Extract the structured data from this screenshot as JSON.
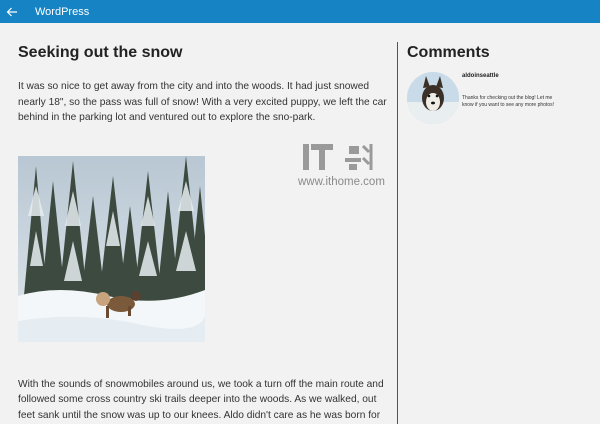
{
  "app": {
    "title": "WordPress"
  },
  "post": {
    "title": "Seeking out the snow",
    "paragraph1": "It was so nice to get away from the city and into the woods.  It had just snowed nearly 18\", so the pass was full of snow!  With a very excited puppy, we left the car behind in the parking lot and ventured out to explore the sno-park.",
    "paragraph2": "With the sounds of snowmobiles around us, we took a turn off the main route and followed some cross country ski trails deeper into the woods.  As we walked, out feet sank until the snow was up to our knees.  Aldo didn't care as he was born for this weather.  When we found a clearing, we brought out the camera gear so"
  },
  "comments": {
    "title": "Comments",
    "items": [
      {
        "user": "aldoinseattle",
        "text": "Thanks for checking out the blog! Let me know if you want to see any more photos!"
      }
    ]
  },
  "watermark": {
    "text": "www.ithome.com"
  },
  "colors": {
    "titlebar": "#1683c5",
    "background": "#f2f2f2"
  }
}
